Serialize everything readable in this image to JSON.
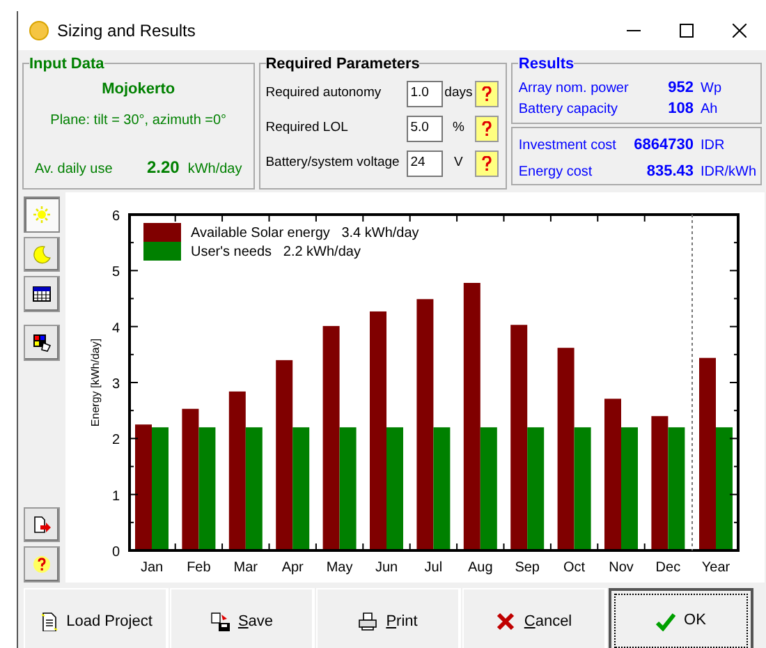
{
  "window": {
    "title": "Sizing and Results"
  },
  "input_data": {
    "title": "Input Data",
    "site": "Mojokerto",
    "plane": "Plane: tilt = 30°, azimuth =0°",
    "daily_use_label": "Av. daily use",
    "daily_use_value": "2.20",
    "daily_use_unit": "kWh/day"
  },
  "required_parameters": {
    "title": "Required Parameters",
    "rows": [
      {
        "label": "Required autonomy",
        "value": "1.0",
        "unit": "days"
      },
      {
        "label": "Required LOL",
        "value": "5.0",
        "unit": "%"
      },
      {
        "label": "Battery/system voltage",
        "value": "24",
        "unit": "V"
      }
    ]
  },
  "results": {
    "title": "Results",
    "sizing": [
      {
        "label": "Array nom. power",
        "value": "952",
        "unit": "Wp"
      },
      {
        "label": "Battery capacity",
        "value": "108",
        "unit": "Ah"
      }
    ],
    "costs": [
      {
        "label": "Investment cost",
        "value": "6864730",
        "unit": "IDR"
      },
      {
        "label": "Energy cost",
        "value": "835.43",
        "unit": "IDR/kWh"
      }
    ]
  },
  "side_tools": [
    {
      "kind": "sun",
      "selected": true
    },
    {
      "kind": "moon",
      "selected": false
    },
    {
      "kind": "table",
      "selected": false
    },
    {
      "kind": "palette",
      "selected": false
    },
    {
      "kind": "export",
      "selected": false
    },
    {
      "kind": "help",
      "selected": false
    }
  ],
  "chart": {
    "chart_data": {
      "type": "bar",
      "ylabel": "Energy [kWh/day]",
      "categories": [
        "Jan",
        "Feb",
        "Mar",
        "Apr",
        "May",
        "Jun",
        "Jul",
        "Aug",
        "Sep",
        "Oct",
        "Nov",
        "Dec",
        "Year"
      ],
      "legend": "upper left",
      "ylim": [
        0,
        6
      ],
      "yticks": [
        0,
        1,
        2,
        3,
        4,
        5,
        6
      ],
      "series": [
        {
          "name": "Available Solar energy   3.4 kWh/day",
          "color": "#800000",
          "values": [
            2.25,
            2.53,
            2.84,
            3.4,
            4.01,
            4.27,
            4.49,
            4.78,
            4.03,
            3.62,
            2.71,
            2.4,
            3.44
          ]
        },
        {
          "name": "User's needs   2.2 kWh/day",
          "color": "#008000",
          "values": [
            2.2,
            2.2,
            2.2,
            2.2,
            2.2,
            2.2,
            2.2,
            2.2,
            2.2,
            2.2,
            2.2,
            2.2,
            2.2
          ]
        }
      ]
    }
  },
  "buttons": [
    {
      "label": "Load Project",
      "kind": "load",
      "mnemonic": false,
      "focused": false
    },
    {
      "label": "Save",
      "kind": "save",
      "mnemonic": true,
      "focused": false
    },
    {
      "label": "Print",
      "kind": "print",
      "mnemonic": true,
      "focused": false
    },
    {
      "label": "Cancel",
      "kind": "cancel",
      "mnemonic": true,
      "focused": false
    },
    {
      "label": "OK",
      "kind": "ok",
      "mnemonic": false,
      "focused": true
    }
  ]
}
